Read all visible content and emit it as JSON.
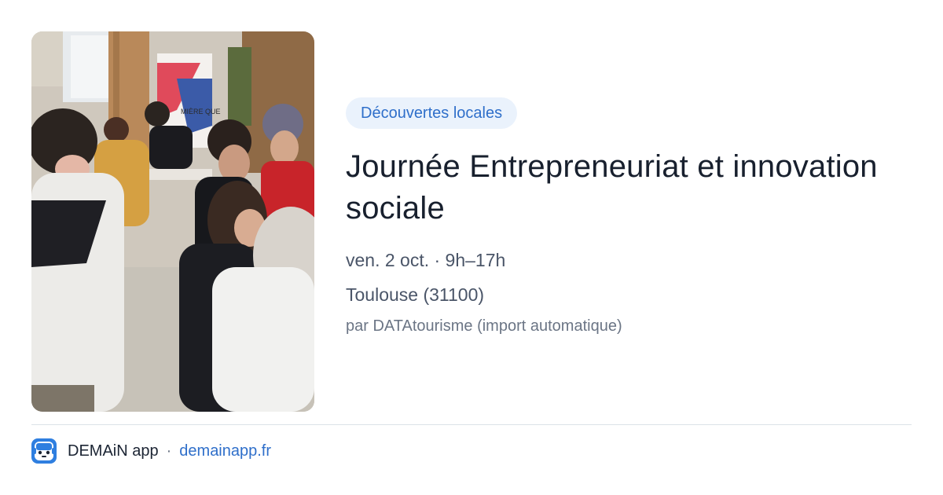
{
  "event": {
    "category": "Découvertes locales",
    "title": "Journée Entrepreneuriat et innovation sociale",
    "date_time": "ven. 2 oct. · 9h–17h",
    "location": "Toulouse (31100)",
    "source": "par DATAtourisme (import automatique)",
    "image_alt": "Personnes réunies lors d'un événement en intérieur",
    "banner_text": "MIÈRE QUE"
  },
  "footer": {
    "app_name": "DEMAiN app",
    "separator": "·",
    "link_text": "demainapp.fr",
    "logo_icon": "demain-app-logo-icon"
  },
  "colors": {
    "accent": "#2f6fca",
    "badge_bg": "#eaf2fc",
    "title": "#18202e",
    "muted": "#4a5568",
    "divider": "#dbe2e8"
  }
}
